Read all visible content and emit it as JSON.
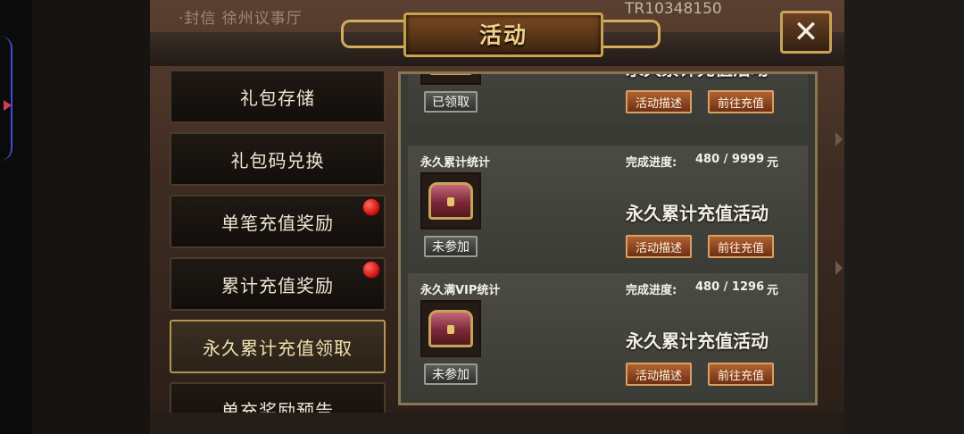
{
  "background": {
    "hud_left": "·封信 徐州议事厅",
    "hud_right": "TR10348150"
  },
  "dialog": {
    "title": "活动",
    "close_icon": "close-x-icon"
  },
  "nav": {
    "items": [
      {
        "label": "礼包存储",
        "active": false,
        "badge": false
      },
      {
        "label": "礼包码兑换",
        "active": false,
        "badge": false
      },
      {
        "label": "单笔充值奖励",
        "active": false,
        "badge": true
      },
      {
        "label": "累计充值奖励",
        "active": false,
        "badge": true
      },
      {
        "label": "永久累计充值领取",
        "active": true,
        "badge": false
      },
      {
        "label": "单充奖励预告",
        "active": false,
        "badge": false
      }
    ]
  },
  "cards": [
    {
      "title": "",
      "progress_label": "",
      "progress_value": "",
      "unit": "",
      "name": "永久累计充值活动",
      "status": "已领取",
      "desc_button": "活动描述",
      "go_button": "前往充值"
    },
    {
      "title": "永久累计统计",
      "progress_label": "完成进度:",
      "progress_value": "480 / 9999",
      "unit": "元",
      "name": "永久累计充值活动",
      "status": "未参加",
      "desc_button": "活动描述",
      "go_button": "前往充值"
    },
    {
      "title": "永久满VIP统计",
      "progress_label": "完成进度:",
      "progress_value": "480 / 1296",
      "unit": "元",
      "name": "永久累计充值活动",
      "status": "未参加",
      "desc_button": "活动描述",
      "go_button": "前往充值"
    }
  ],
  "colors": {
    "accent_gold": "#c9a35a",
    "button_orange": "#b06132",
    "badge_red": "#c90d0d"
  }
}
